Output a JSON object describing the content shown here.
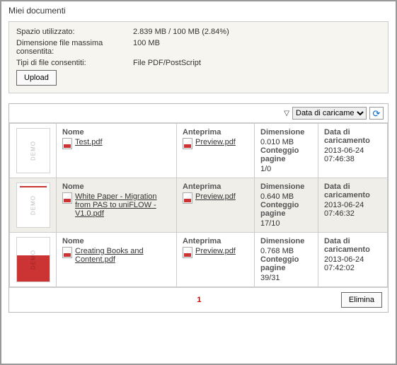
{
  "title": "Miei documenti",
  "info": {
    "storage_label": "Spazio utilizzato:",
    "storage_value": "2.839 MB / 100 MB (2.84%)",
    "maxsize_label": "Dimensione file massima consentita:",
    "maxsize_value": "100  MB",
    "types_label": "Tipi di file consentiti:",
    "types_value": "File PDF/PostScript",
    "upload_button": "Upload"
  },
  "toolbar": {
    "sort_selected": "Data di caricame"
  },
  "columns": {
    "name": "Nome",
    "preview": "Anteprima",
    "dimension": "Dimensione",
    "pagecount": "Conteggio pagine",
    "uploaddate": "Data di caricamento"
  },
  "rows": [
    {
      "thumb_class": "plain",
      "name": "Test.pdf",
      "preview": "Preview.pdf",
      "size": "0.010 MB",
      "pages": "1/0",
      "date": "2013-06-24",
      "time": "07:46:38"
    },
    {
      "thumb_class": "red-accent",
      "name": "White Paper - Migration from PAS to uniFLOW - V1.0.pdf",
      "preview": "Preview.pdf",
      "size": "0.640 MB",
      "pages": "17/10",
      "date": "2013-06-24",
      "time": "07:46:32"
    },
    {
      "thumb_class": "cover",
      "name": "Creating Books and Content.pdf",
      "preview": "Preview.pdf",
      "size": "0.768 MB",
      "pages": "39/31",
      "date": "2013-06-24",
      "time": "07:42:02"
    }
  ],
  "footer": {
    "page": "1",
    "delete_button": "Elimina"
  }
}
